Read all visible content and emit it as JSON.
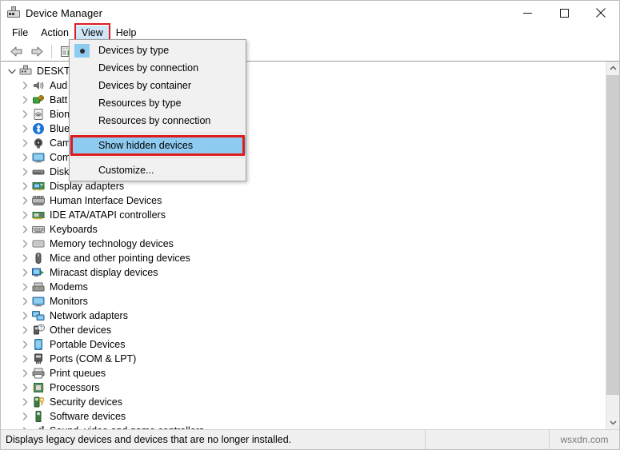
{
  "window": {
    "title": "Device Manager",
    "icon": "device-manager-icon",
    "controls": {
      "minimize": "minimize-icon",
      "maximize": "maximize-icon",
      "close": "close-icon"
    }
  },
  "menubar": {
    "items": [
      {
        "label": "File",
        "active": false,
        "annotated": false
      },
      {
        "label": "Action",
        "active": false,
        "annotated": false
      },
      {
        "label": "View",
        "active": true,
        "annotated": true
      },
      {
        "label": "Help",
        "active": false,
        "annotated": false
      }
    ]
  },
  "toolbar": {
    "buttons": [
      {
        "name": "back-arrow-icon"
      },
      {
        "name": "forward-arrow-icon"
      },
      {
        "name": "properties-icon"
      }
    ]
  },
  "view_menu": {
    "items": [
      {
        "label": "Devices by type",
        "radio": true,
        "selected": false,
        "annotated": false,
        "separator_before": false
      },
      {
        "label": "Devices by connection",
        "radio": false,
        "selected": false,
        "annotated": false,
        "separator_before": false
      },
      {
        "label": "Devices by container",
        "radio": false,
        "selected": false,
        "annotated": false,
        "separator_before": false
      },
      {
        "label": "Resources by type",
        "radio": false,
        "selected": false,
        "annotated": false,
        "separator_before": false
      },
      {
        "label": "Resources by connection",
        "radio": false,
        "selected": false,
        "annotated": false,
        "separator_before": false
      },
      {
        "label": "Show hidden devices",
        "radio": false,
        "selected": true,
        "annotated": true,
        "separator_before": true
      },
      {
        "label": "Customize...",
        "radio": false,
        "selected": false,
        "annotated": false,
        "separator_before": true
      }
    ]
  },
  "tree": {
    "root": {
      "label": "DESKTO",
      "icon": "computer-icon",
      "expanded": true
    },
    "items": [
      {
        "label": "Aud",
        "icon": "speaker-icon"
      },
      {
        "label": "Batt",
        "icon": "battery-icon"
      },
      {
        "label": "Bion",
        "icon": "fingerprint-icon"
      },
      {
        "label": "Blue",
        "icon": "bluetooth-icon"
      },
      {
        "label": "Cam",
        "icon": "camera-icon"
      },
      {
        "label": "Com",
        "icon": "monitor-icon"
      },
      {
        "label": "Disk",
        "icon": "disk-drive-icon"
      },
      {
        "label": "Display adapters",
        "icon": "display-adapter-icon"
      },
      {
        "label": "Human Interface Devices",
        "icon": "hid-icon"
      },
      {
        "label": "IDE ATA/ATAPI controllers",
        "icon": "ide-controller-icon"
      },
      {
        "label": "Keyboards",
        "icon": "keyboard-icon"
      },
      {
        "label": "Memory technology devices",
        "icon": "memory-icon"
      },
      {
        "label": "Mice and other pointing devices",
        "icon": "mouse-icon"
      },
      {
        "label": "Miracast display devices",
        "icon": "miracast-icon"
      },
      {
        "label": "Modems",
        "icon": "modem-icon"
      },
      {
        "label": "Monitors",
        "icon": "monitor-icon"
      },
      {
        "label": "Network adapters",
        "icon": "network-adapter-icon"
      },
      {
        "label": "Other devices",
        "icon": "other-device-icon"
      },
      {
        "label": "Portable Devices",
        "icon": "portable-device-icon"
      },
      {
        "label": "Ports (COM & LPT)",
        "icon": "port-icon"
      },
      {
        "label": "Print queues",
        "icon": "printer-icon"
      },
      {
        "label": "Processors",
        "icon": "processor-icon"
      },
      {
        "label": "Security devices",
        "icon": "security-device-icon"
      },
      {
        "label": "Software devices",
        "icon": "software-device-icon"
      },
      {
        "label": "Sound, video and game controllers",
        "icon": "sound-controller-icon"
      }
    ]
  },
  "statusbar": {
    "text": "Displays legacy devices and devices that are no longer installed.",
    "watermark": "wsxdn.com"
  },
  "colors": {
    "accent_highlight": "#8ecbf0",
    "menu_active": "#cfe8f8",
    "annotation_red": "#e01b1b",
    "chrome": "#f0f0f0"
  }
}
